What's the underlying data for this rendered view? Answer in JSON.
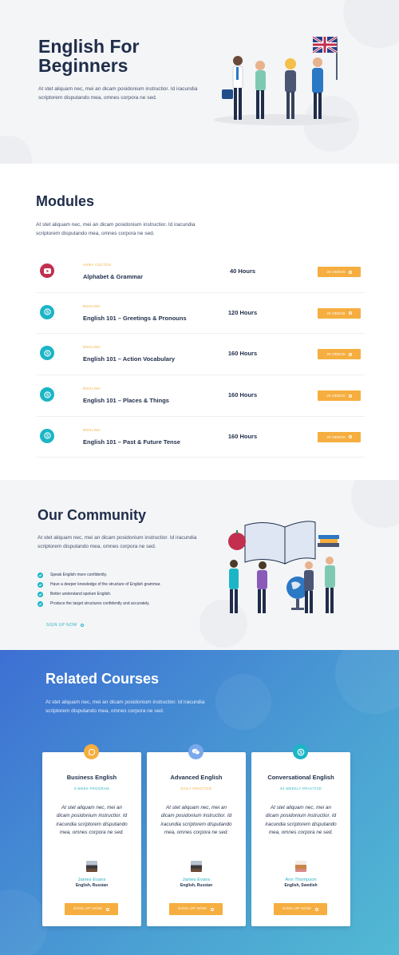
{
  "hero": {
    "title": "English For Beginners",
    "text": "At stet aliquam nec, mei an dicam posidonium instructior. Id iracundia scriptorem disputando mea, omnes corpora ne sed."
  },
  "modules": {
    "title": "Modules",
    "text": "At stet aliquam nec, mei an dicam posidonium instructior. Id iracundia scriptorem disputando mea, omnes corpora ne sed.",
    "items": [
      {
        "tag": "ANNA COLTON",
        "name": "Alphabet & Grammar",
        "hours": "40 Hours",
        "button": "20 VIDEOS",
        "icon": "youtube-icon",
        "color": "#c22f4f"
      },
      {
        "tag": "ENGLISH",
        "name": "English 101 – Greetings & Pronouns",
        "hours": "120 Hours",
        "button": "20 VIDEOS",
        "icon": "skype-icon",
        "color": "#1bb5c6"
      },
      {
        "tag": "ENGLISH",
        "name": "English 101 – Action Vocabulary",
        "hours": "160 Hours",
        "button": "20 VIDEOS",
        "icon": "skype-icon",
        "color": "#1bb5c6"
      },
      {
        "tag": "ENGLISH",
        "name": "English 101 – Places & Things",
        "hours": "160 Hours",
        "button": "20 VIDEOS",
        "icon": "skype-icon",
        "color": "#1bb5c6"
      },
      {
        "tag": "ENGLISH",
        "name": "English 101 – Past & Future Tense",
        "hours": "160 Hours",
        "button": "20 VIDEOS",
        "icon": "skype-icon",
        "color": "#1bb5c6"
      }
    ]
  },
  "community": {
    "title": "Our Community",
    "text": "At stet aliquam nec, mei an dicam posidonium instructior. Id iracundia scriptorem disputando mea, omnes corpora ne sed.",
    "items": [
      "Speak English more confidently.",
      "Have a deeper knowledge of the structure of English grammar.",
      "Better understand spoken English.",
      "Produce the target structures confidently and accurately."
    ],
    "link": "SIGN UP NOW"
  },
  "related": {
    "title": "Related Courses",
    "text": "At stet aliquam nec, mei an dicam posidonium instructior. Id iracundia scriptorem disputando mea, omnes corpora ne sed.",
    "cards": [
      {
        "name": "Business English",
        "sub": "8 WEEK PROGRAM",
        "desc": "At stet aliquam nec, mei an dicam posidonium instructior. Id iracundia scriptorem disputando mea, omnes corpora ne sed.",
        "person": "James Evans",
        "langs": "English, Russian",
        "button": "SIGN UP NOW",
        "icon": "whatsapp-icon",
        "icon_color": "#f5ae3f",
        "sub_color": "#2ab3c4",
        "person_color": "#2ab3c4"
      },
      {
        "name": "Advanced English",
        "sub": "DAILY PRACTICE",
        "desc": "At stet aliquam nec, mei an dicam posidonium instructior. Id iracundia scriptorem disputando mea, omnes corpora ne sed.",
        "person": "James Evans",
        "langs": "English, Russian",
        "button": "SIGN UP NOW",
        "icon": "wechat-icon",
        "icon_color": "#5d8fe3",
        "sub_color": "#f0ad3c",
        "person_color": "#2ab3c4"
      },
      {
        "name": "Conversational English",
        "sub": "3X WEEKLY PRACTICE",
        "desc": "At stet aliquam nec, mei an dicam posidonium instructior. Id iracundia scriptorem disputando mea, omnes corpora ne sed.",
        "person": "Ann Thompson",
        "langs": "English, Swedish",
        "button": "SIGN UP NOW",
        "icon": "skype-icon",
        "icon_color": "#1bb5c6",
        "sub_color": "#2ab3c4",
        "person_color": "#2ab3c4"
      }
    ]
  },
  "colors": {
    "accent": "#f5ae3f",
    "teal": "#1bb5c6",
    "navy": "#1f2d4a"
  }
}
